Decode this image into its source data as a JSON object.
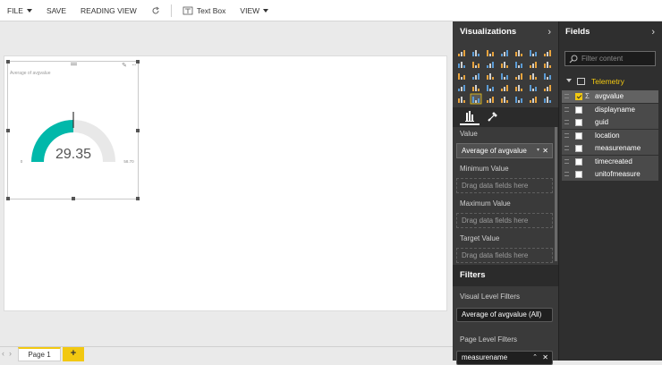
{
  "ribbon": {
    "file": "FILE",
    "save": "SAVE",
    "reading_view": "READING VIEW",
    "text_box": "Text Box",
    "view": "VIEW"
  },
  "visual": {
    "title": "Average of avgvalue",
    "value": "29.35",
    "min_label": "0",
    "max_label": "58.70"
  },
  "chart_data": {
    "type": "gauge",
    "value": 29.35,
    "min": 0,
    "max": 58.7,
    "title": "Average of avgvalue",
    "colors": {
      "fill": "#01b8aa",
      "track": "#e8e8e8"
    }
  },
  "pages": {
    "tab1": "Page 1",
    "add": "+"
  },
  "visualizations": {
    "title": "Visualizations",
    "value_label": "Value",
    "value_field": "Average of avgvalue",
    "min_label": "Minimum Value",
    "max_label": "Maximum Value",
    "target_label": "Target Value",
    "drag_hint": "Drag data fields here"
  },
  "filters": {
    "title": "Filters",
    "visual_level": "Visual Level Filters",
    "visual_filter": "Average of avgvalue (All)",
    "page_level": "Page Level Filters",
    "page_filter": "measurename"
  },
  "fields": {
    "title": "Fields",
    "search_placeholder": "Filter content",
    "table": "Telemetry",
    "items": [
      {
        "name": "avgvalue",
        "checked": true,
        "sigma": "Σ"
      },
      {
        "name": "displayname",
        "checked": false,
        "sigma": ""
      },
      {
        "name": "guid",
        "checked": false,
        "sigma": ""
      },
      {
        "name": "location",
        "checked": false,
        "sigma": ""
      },
      {
        "name": "measurename",
        "checked": false,
        "sigma": ""
      },
      {
        "name": "timecreated",
        "checked": false,
        "sigma": ""
      },
      {
        "name": "unitofmeasure",
        "checked": false,
        "sigma": ""
      }
    ]
  },
  "colors": {
    "accent": "#f2c811",
    "teal": "#01b8aa",
    "pane": "#3a3a3a"
  }
}
